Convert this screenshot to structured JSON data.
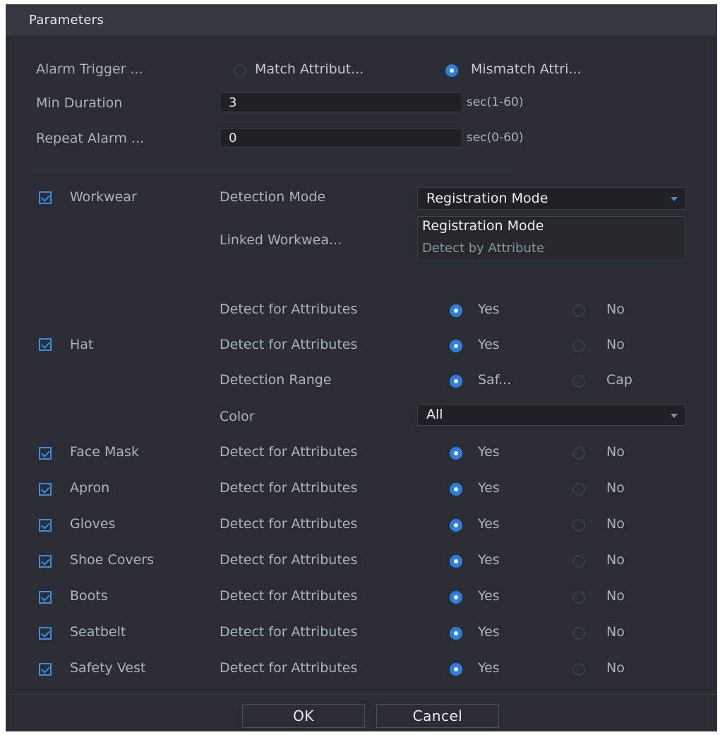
{
  "dialog": {
    "title": "Parameters"
  },
  "alarm": {
    "trigger_label": "Alarm Trigger ...",
    "option_match": "Match Attribut...",
    "option_mismatch": "Mismatch Attri...",
    "selected": "mismatch",
    "min_duration_label": "Min Duration",
    "min_duration_value": "3",
    "min_duration_unit": "sec(1-60)",
    "repeat_label": "Repeat Alarm ...",
    "repeat_value": "0",
    "repeat_unit": "sec(0-60)"
  },
  "workwear": {
    "label": "Workwear",
    "checked": true,
    "detection_mode_label": "Detection Mode",
    "detection_mode_value": "Registration Mode",
    "linked_label": "Linked Workwea...",
    "dropdown_options": [
      "Registration Mode",
      "Detect by Attribute"
    ],
    "detect_label": "Detect for Attributes",
    "yes": "Yes",
    "no": "No",
    "value": "Yes"
  },
  "hat": {
    "label": "Hat",
    "checked": true,
    "detect_label": "Detect for Attributes",
    "yes": "Yes",
    "no": "No",
    "value": "Yes",
    "range_label": "Detection Range",
    "range_option_1": "Saf...",
    "range_option_2": "Cap",
    "range_value": "Saf...",
    "color_label": "Color",
    "color_value": "All"
  },
  "items": [
    {
      "label": "Face Mask",
      "checked": true,
      "detect_label": "Detect for Attributes",
      "yes": "Yes",
      "no": "No",
      "value": "Yes"
    },
    {
      "label": "Apron",
      "checked": true,
      "detect_label": "Detect for Attributes",
      "yes": "Yes",
      "no": "No",
      "value": "Yes"
    },
    {
      "label": "Gloves",
      "checked": true,
      "detect_label": "Detect for Attributes",
      "yes": "Yes",
      "no": "No",
      "value": "Yes"
    },
    {
      "label": "Shoe Covers",
      "checked": true,
      "detect_label": "Detect for Attributes",
      "yes": "Yes",
      "no": "No",
      "value": "Yes"
    },
    {
      "label": "Boots",
      "checked": true,
      "detect_label": "Detect for Attributes",
      "yes": "Yes",
      "no": "No",
      "value": "Yes"
    },
    {
      "label": "Seatbelt",
      "checked": true,
      "detect_label": "Detect for Attributes",
      "yes": "Yes",
      "no": "No",
      "value": "Yes"
    },
    {
      "label": "Safety Vest",
      "checked": true,
      "detect_label": "Detect for Attributes",
      "yes": "Yes",
      "no": "No",
      "value": "Yes"
    }
  ],
  "buttons": {
    "ok": "OK",
    "cancel": "Cancel"
  },
  "colors": {
    "accent": "#2c7ee0",
    "background": "#2a2d33",
    "titlebar": "#34383f"
  }
}
